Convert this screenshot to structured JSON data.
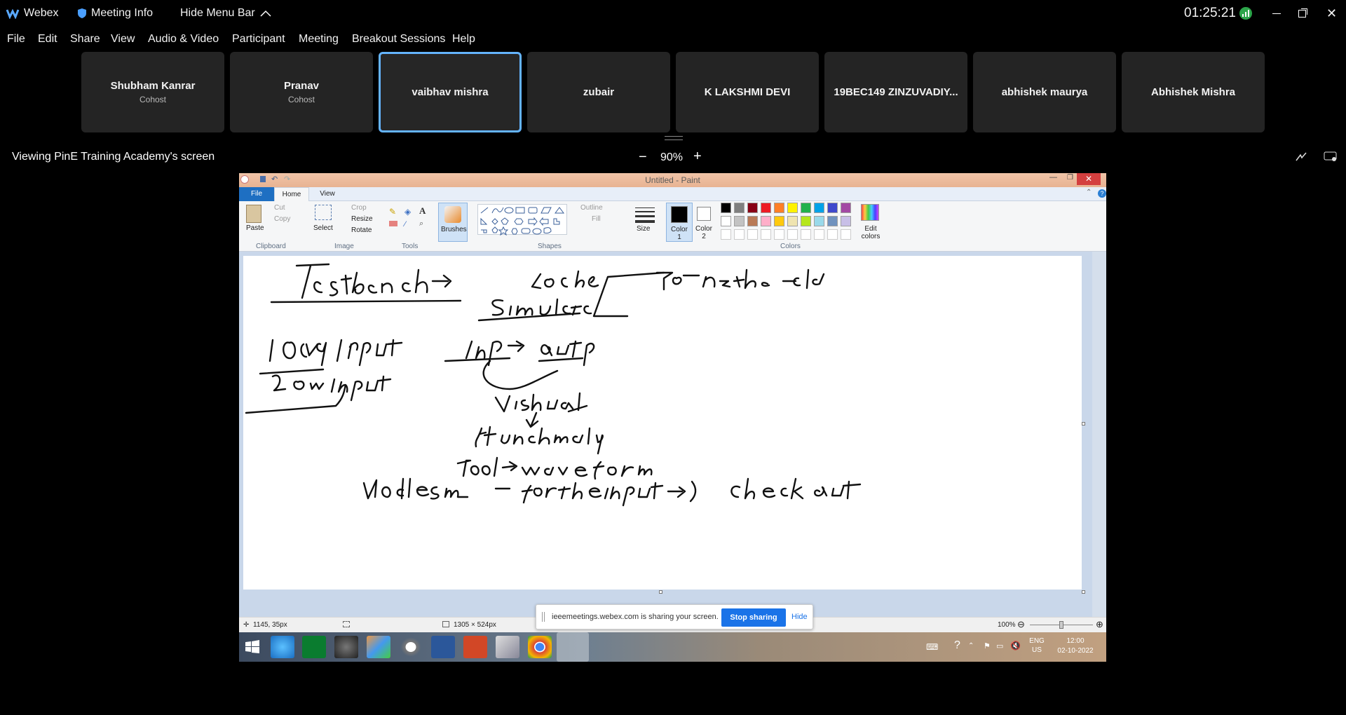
{
  "titlebar": {
    "app_name": "Webex",
    "meeting_info": "Meeting Info",
    "hide_menu_bar": "Hide Menu Bar",
    "clock": "01:25:21"
  },
  "menu": [
    "File",
    "Edit",
    "Share",
    "View",
    "Audio & Video",
    "Participant",
    "Meeting",
    "Breakout Sessions",
    "Help"
  ],
  "participants": [
    {
      "name": "Shubham Kanrar",
      "role": "Cohost"
    },
    {
      "name": "Pranav",
      "role": "Cohost"
    },
    {
      "name": "vaibhav mishra",
      "role": ""
    },
    {
      "name": "zubair",
      "role": ""
    },
    {
      "name": "K LAKSHMI DEVI",
      "role": ""
    },
    {
      "name": "19BEC149 ZINZUVADIY...",
      "role": ""
    },
    {
      "name": "abhishek maurya",
      "role": ""
    },
    {
      "name": "Abhishek Mishra",
      "role": ""
    }
  ],
  "viewing": {
    "label": "Viewing PinE Training Academy's screen",
    "zoom": "90%"
  },
  "paint": {
    "title": "Untitled - Paint",
    "tabs": {
      "file": "File",
      "home": "Home",
      "view": "View"
    },
    "ribbon": {
      "paste": "Paste",
      "cut": "Cut",
      "copy": "Copy",
      "clipboard": "Clipboard",
      "select": "Select",
      "crop": "Crop",
      "resize": "Resize",
      "rotate": "Rotate",
      "image": "Image",
      "tools": "Tools",
      "brushes": "Brushes",
      "outline": "Outline",
      "fill": "Fill",
      "shapes": "Shapes",
      "size": "Size",
      "color1": "Color 1",
      "color2": "Color 2",
      "edit_colors": "Edit colors",
      "colors": "Colors"
    },
    "status": {
      "cursor": "1145, 35px",
      "dimensions": "1305 × 524px",
      "zoom": "100%"
    }
  },
  "palette": [
    "#000000",
    "#7f7f7f",
    "#880015",
    "#ed1c24",
    "#ff7f27",
    "#fff200",
    "#22b14c",
    "#00a2e8",
    "#3f48cc",
    "#a349a4",
    "#ffffff",
    "#c3c3c3",
    "#b97a57",
    "#ffaec9",
    "#ffc90e",
    "#efe4b0",
    "#b5e61d",
    "#99d9ea",
    "#7092be",
    "#c8bfe7"
  ],
  "taskbar": {
    "lang1": "ENG",
    "lang2": "US",
    "time": "12:00",
    "date": "02-10-2022"
  },
  "share_bar": {
    "message": "ieeemeetings.webex.com is sharing your screen.",
    "stop": "Stop sharing",
    "hide": "Hide"
  }
}
